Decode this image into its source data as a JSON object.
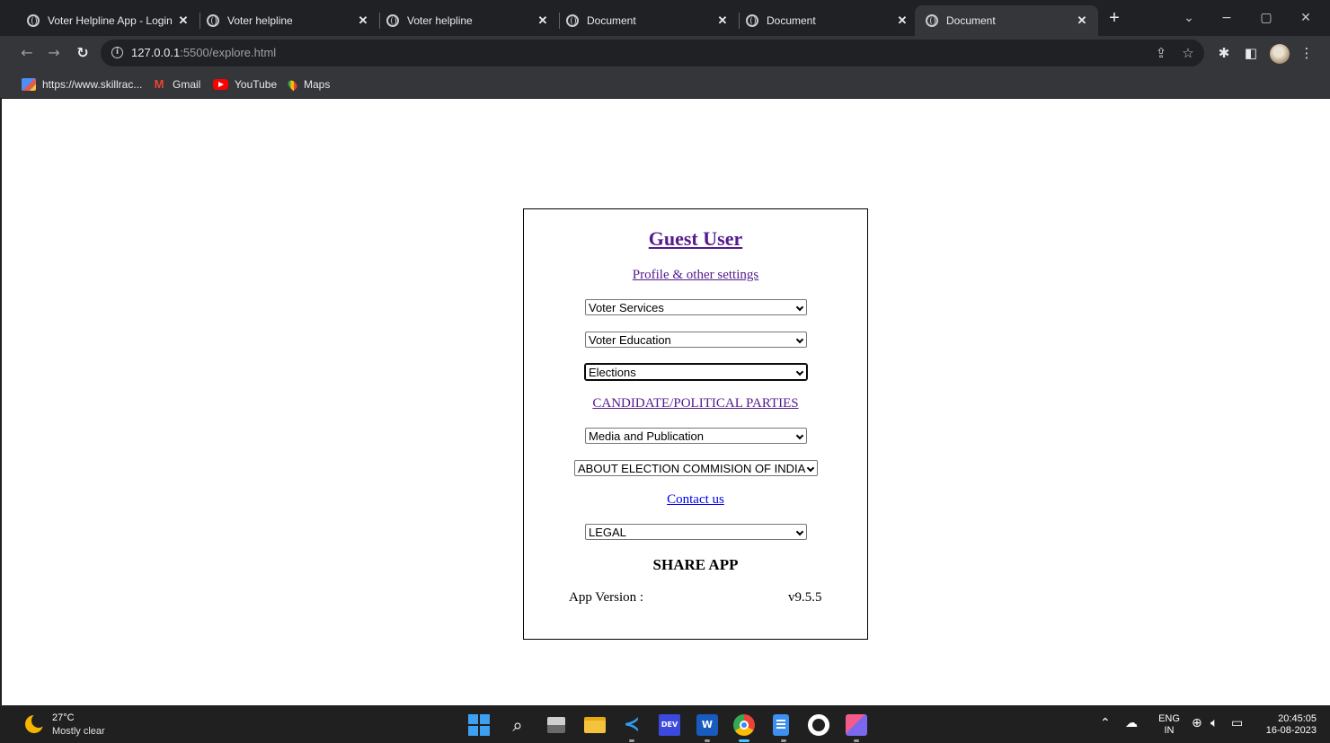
{
  "browser": {
    "tabs": [
      {
        "title": "Voter Helpline App - Login"
      },
      {
        "title": "Voter helpline"
      },
      {
        "title": "Voter helpline"
      },
      {
        "title": "Document"
      },
      {
        "title": "Document"
      },
      {
        "title": "Document"
      }
    ],
    "address": {
      "host": "127.0.0.1",
      "path": ":5500/explore.html"
    },
    "bookmarks": [
      {
        "label": "https://www.skillrac..."
      },
      {
        "label": "Gmail"
      },
      {
        "label": "YouTube"
      },
      {
        "label": "Maps"
      }
    ]
  },
  "card": {
    "title": "Guest User",
    "profile_link": "Profile & other settings",
    "voter_services": "Voter Services",
    "voter_education": "Voter Education",
    "elections": "Elections",
    "candidate_link": "CANDIDATE/POLITICAL PARTIES",
    "media": "Media and Publication",
    "about_eci": "ABOUT ELECTION COMMISION OF INDIA",
    "contact_link": "Contact us",
    "legal": "LEGAL",
    "share": "SHARE APP",
    "version_label": "App Version :",
    "version_value": "v9.5.5"
  },
  "taskbar": {
    "weather": {
      "temp": "27°C",
      "desc": "Mostly clear"
    },
    "language": {
      "line1": "ENG",
      "line2": "IN"
    },
    "clock": {
      "time": "20:45:05",
      "date": "16-08-2023"
    }
  }
}
